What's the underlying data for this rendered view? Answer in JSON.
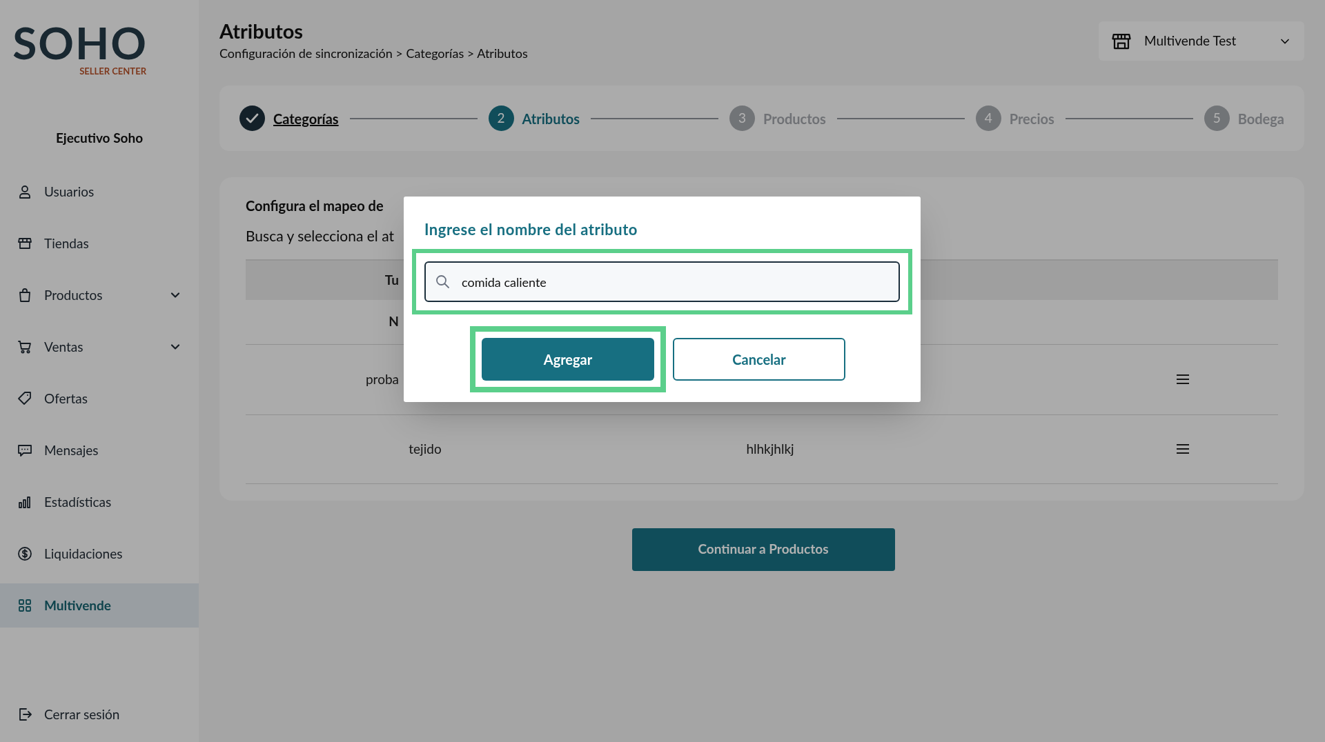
{
  "logo": {
    "wordmark": "SOHO",
    "tagline": "SELLER CENTER"
  },
  "sidebar": {
    "user": "Ejecutivo Soho",
    "items": [
      {
        "label": "Usuarios",
        "expandable": false,
        "selected": false
      },
      {
        "label": "Tiendas",
        "expandable": false,
        "selected": false
      },
      {
        "label": "Productos",
        "expandable": true,
        "selected": false
      },
      {
        "label": "Ventas",
        "expandable": true,
        "selected": false
      },
      {
        "label": "Ofertas",
        "expandable": false,
        "selected": false
      },
      {
        "label": "Mensajes",
        "expandable": false,
        "selected": false
      },
      {
        "label": "Estadísticas",
        "expandable": false,
        "selected": false
      },
      {
        "label": "Liquidaciones",
        "expandable": false,
        "selected": false
      },
      {
        "label": "Multivende",
        "expandable": false,
        "selected": true
      }
    ],
    "logout": "Cerrar sesión"
  },
  "header": {
    "title": "Atributos",
    "breadcrumb": "Configuración de sincronización > Categorías > Atributos",
    "store": "Multivende Test"
  },
  "steps": [
    {
      "label": "Categorías",
      "completed": true,
      "selected": false
    },
    {
      "number": "2",
      "label": "Atributos",
      "completed": false,
      "selected": true
    },
    {
      "number": "3",
      "label": "Productos",
      "completed": false,
      "selected": false
    },
    {
      "number": "4",
      "label": "Precios",
      "completed": false,
      "selected": false
    },
    {
      "number": "5",
      "label": "Bodega",
      "completed": false,
      "selected": false
    }
  ],
  "card": {
    "heading": "Configura el mapeo de",
    "subtitle": "Busca y selecciona el at",
    "rows": [
      {
        "kind": "header",
        "column_1": "Tu"
      },
      {
        "kind": "subheader",
        "column_1": "N"
      },
      {
        "kind": "partial",
        "column_1": "proba",
        "menu": true
      },
      {
        "kind": "full",
        "column_1": "tejido",
        "column_2": "hlhkjhlkj",
        "menu": true
      }
    ]
  },
  "continue_button": "Continuar a Productos",
  "dialog": {
    "title": "Ingrese el nombre del atributo",
    "value": "comida caliente",
    "buttons": [
      {
        "label": "Agregar",
        "kind": "primary"
      },
      {
        "label": "Cancelar",
        "kind": "secondary"
      }
    ]
  }
}
